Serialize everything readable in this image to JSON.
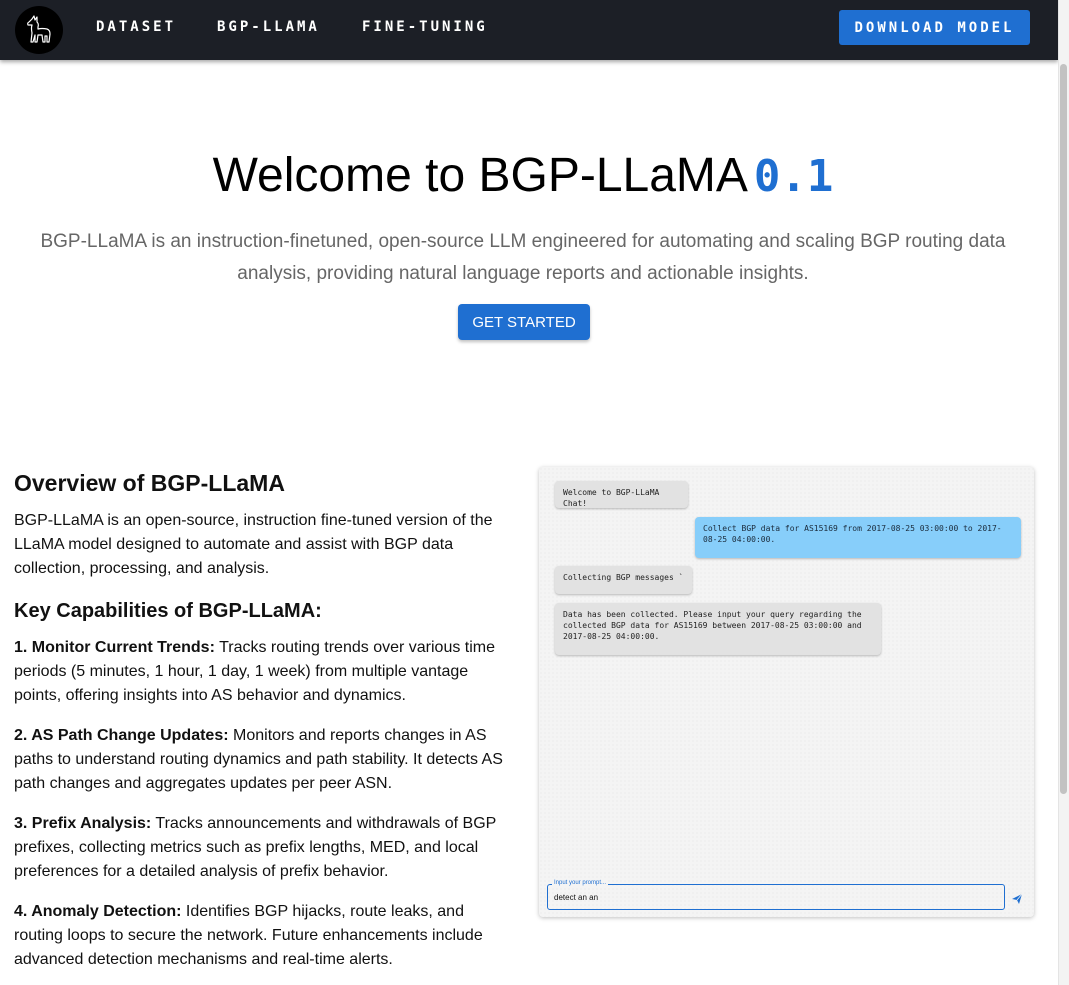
{
  "nav": {
    "links": [
      "DATASET",
      "BGP-LLAMA",
      "FINE-TUNING"
    ],
    "download_label": "DOWNLOAD MODEL",
    "logo_icon": "llama-logo-icon"
  },
  "hero": {
    "title": "Welcome to BGP-LLaMA",
    "version": "0.1",
    "subtitle": "BGP-LLaMA is an instruction-finetuned, open-source LLM engineered for automating and scaling BGP routing data analysis, providing natural language reports and actionable insights.",
    "cta_label": "GET STARTED"
  },
  "overview": {
    "title": "Overview of BGP-LLaMA",
    "text": "BGP-LLaMA is an open-source, instruction fine-tuned version of the LLaMA model designed to automate and assist with BGP data collection, processing, and analysis.",
    "capabilities_title": "Key Capabilities of BGP-LLaMA:",
    "capabilities": [
      {
        "heading": "1. Monitor Current Trends:",
        "text": " Tracks routing trends over various time periods (5 minutes, 1 hour, 1 day, 1 week) from multiple vantage points, offering insights into AS behavior and dynamics."
      },
      {
        "heading": "2. AS Path Change Updates:",
        "text": " Monitors and reports changes in AS paths to understand routing dynamics and path stability. It detects AS path changes and aggregates updates per peer ASN."
      },
      {
        "heading": "3. Prefix Analysis:",
        "text": " Tracks announcements and withdrawals of BGP prefixes, collecting metrics such as prefix lengths, MED, and local preferences for a detailed analysis of prefix behavior."
      },
      {
        "heading": "4. Anomaly Detection:",
        "text": " Identifies BGP hijacks, route leaks, and routing loops to secure the network. Future enhancements include advanced detection mechanisms and real-time alerts."
      }
    ]
  },
  "chat": {
    "messages": [
      {
        "role": "bot",
        "text": "Welcome to BGP-LLaMA Chat!"
      },
      {
        "role": "user",
        "text": "Collect BGP data for AS15169 from 2017-08-25 03:00:00 to 2017-08-25 04:00:00."
      },
      {
        "role": "bot",
        "text": "Collecting BGP messages  `"
      },
      {
        "role": "bot",
        "text": "Data has been collected. Please input your query regarding the collected BGP data for AS15169 between 2017-08-25 03:00:00 and 2017-08-25 04:00:00."
      }
    ],
    "input_label": "Input your prompt...",
    "input_value": "detect an an",
    "send_icon": "send-icon"
  }
}
